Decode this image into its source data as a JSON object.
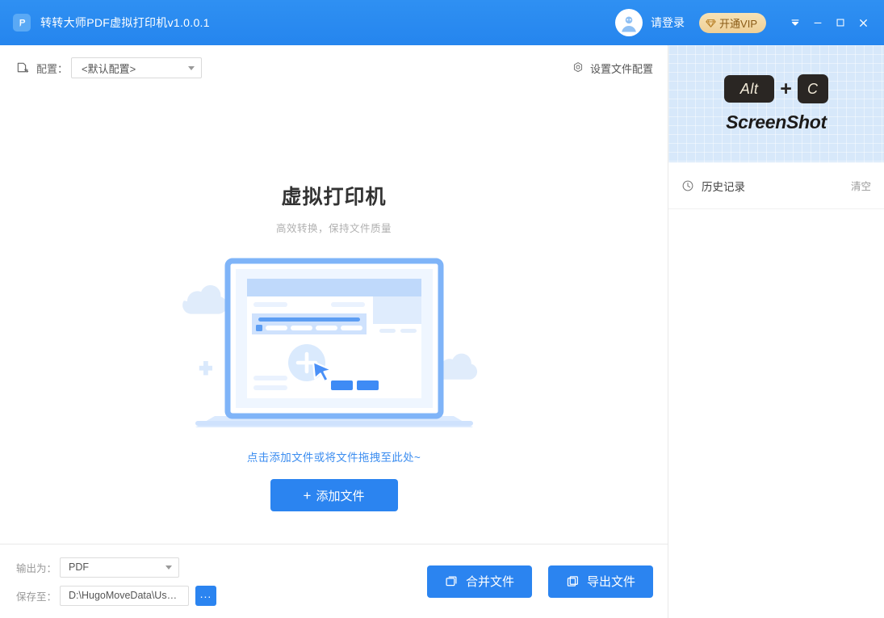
{
  "titlebar": {
    "app_icon": "pdf-printer-logo-icon",
    "title": "转转大师PDF虚拟打印机v1.0.0.1",
    "login_label": "请登录",
    "avatar_icon": "user-avatar-icon",
    "vip_label": "开通VIP",
    "vip_icon": "diamond-icon",
    "bg_color": "#2b8cf0",
    "vip_bg_color": "#f3d9a8",
    "vip_text_color": "#8a5b16",
    "controls": {
      "menu_icon": "collapse-arrow-icon",
      "minimize_icon": "minimize-icon",
      "maximize_icon": "maximize-icon",
      "close_icon": "close-icon"
    }
  },
  "configbar": {
    "icon": "config-file-icon",
    "label": "配置：",
    "selected_config": "<默认配置>",
    "settings_icon": "gear-icon",
    "settings_label": "设置文件配置"
  },
  "dropzone": {
    "title": "虚拟打印机",
    "subtitle": "高效转换，保持文件质量",
    "illustration": "laptop-add-file-illustration",
    "hint": "点击添加文件或将文件拖拽至此处~",
    "add_button": "添加文件",
    "add_icon": "plus-icon",
    "link_color": "#3d8ef0",
    "accent_color": "#2b84f0"
  },
  "bottombar": {
    "output_label": "输出为：",
    "output_value": "PDF",
    "save_label": "保存至：",
    "save_value": "D:\\HugoMoveData\\User\\Ad...",
    "browse_label": "...",
    "merge_button": "合并文件",
    "merge_icon": "merge-file-icon",
    "export_button": "导出文件",
    "export_icon": "export-file-icon"
  },
  "sidebar": {
    "promo": {
      "key1": "Alt",
      "plus": "+",
      "key2": "C",
      "word": "ScreenShot",
      "bg_color": "#d7e8fa"
    },
    "history": {
      "icon": "clock-icon",
      "title": "历史记录",
      "clear_label": "清空",
      "items": []
    }
  }
}
